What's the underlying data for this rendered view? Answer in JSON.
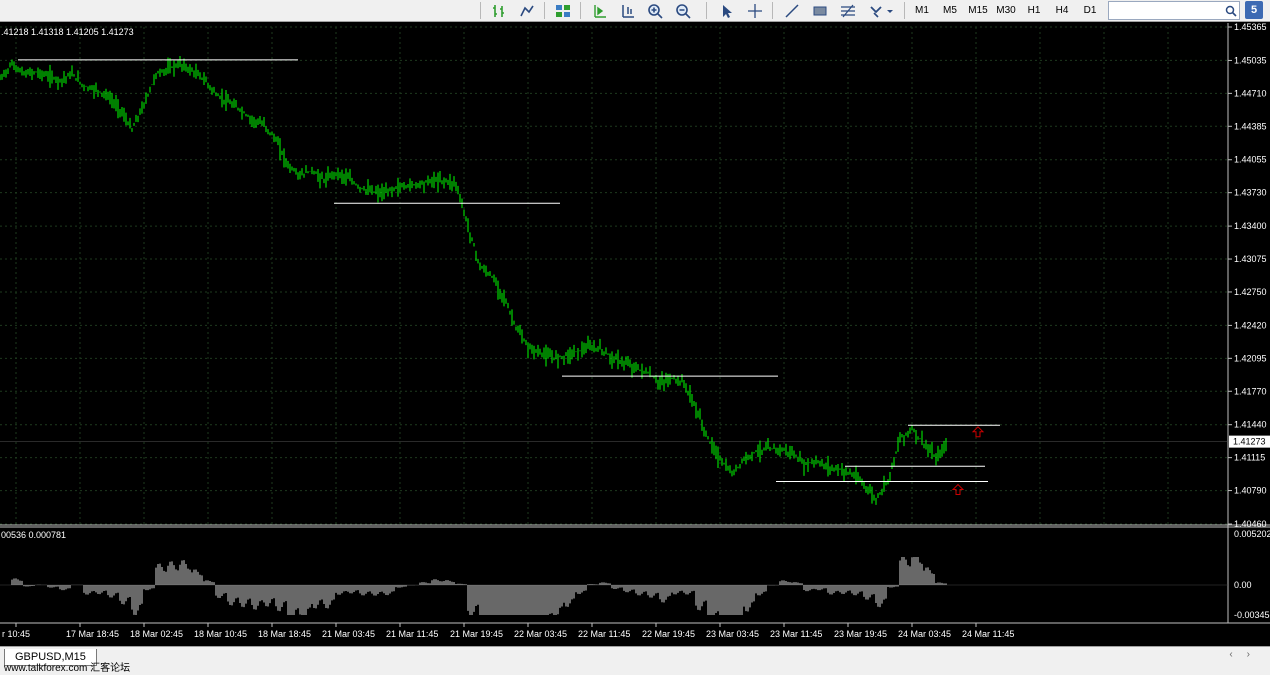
{
  "toolbar": {
    "timeframes": [
      "M1",
      "M5",
      "M15",
      "M30",
      "H1",
      "H4",
      "D1"
    ],
    "badge": "5"
  },
  "chart": {
    "ohlc_text": ".41218 1.41318 1.41205 1.41273",
    "current_price": "1.41273",
    "price_ticks": [
      "1.45365",
      "1.45035",
      "1.44710",
      "1.44385",
      "1.44055",
      "1.43730",
      "1.43400",
      "1.43075",
      "1.42750",
      "1.42420",
      "1.42095",
      "1.41770",
      "1.41440",
      "1.41115",
      "1.40790",
      "1.40460"
    ],
    "time_ticks": [
      "r 10:45",
      "17 Mar 18:45",
      "18 Mar 02:45",
      "18 Mar 10:45",
      "18 Mar 18:45",
      "21 Mar 03:45",
      "21 Mar 11:45",
      "21 Mar 19:45",
      "22 Mar 03:45",
      "22 Mar 11:45",
      "22 Mar 19:45",
      "23 Mar 03:45",
      "23 Mar 11:45",
      "23 Mar 19:45",
      "24 Mar 03:45",
      "24 Mar 11:45"
    ],
    "indicator_text": "00536 0.000781",
    "indicator_ticks": [
      "0.005202",
      "0.00",
      "-0.003458"
    ],
    "colors": {
      "bars": "#00ff00",
      "lines": "#ffffff",
      "arrows": "#cc0000",
      "grid": "#1e3a1e"
    }
  },
  "chart_data": {
    "type": "line",
    "title": "GBPUSD,M15",
    "ylim": [
      1.4046,
      1.45365
    ],
    "price_path": [
      [
        0,
        1.4485
      ],
      [
        2,
        1.45
      ],
      [
        4,
        1.449
      ],
      [
        6,
        1.4492
      ],
      [
        8,
        1.4488
      ],
      [
        10,
        1.4484
      ],
      [
        12,
        1.449
      ],
      [
        14,
        1.4478
      ],
      [
        16,
        1.4475
      ],
      [
        18,
        1.4468
      ],
      [
        20,
        1.4455
      ],
      [
        22,
        1.4435
      ],
      [
        24,
        1.446
      ],
      [
        26,
        1.449
      ],
      [
        28,
        1.4495
      ],
      [
        30,
        1.45
      ],
      [
        32,
        1.4493
      ],
      [
        34,
        1.4485
      ],
      [
        36,
        1.447
      ],
      [
        38,
        1.4462
      ],
      [
        40,
        1.4455
      ],
      [
        42,
        1.4445
      ],
      [
        44,
        1.444
      ],
      [
        46,
        1.4425
      ],
      [
        48,
        1.44
      ],
      [
        50,
        1.439
      ],
      [
        52,
        1.4395
      ],
      [
        54,
        1.4385
      ],
      [
        56,
        1.4393
      ],
      [
        58,
        1.4387
      ],
      [
        60,
        1.4378
      ],
      [
        62,
        1.4374
      ],
      [
        64,
        1.4372
      ],
      [
        66,
        1.4378
      ],
      [
        68,
        1.438
      ],
      [
        70,
        1.4382
      ],
      [
        72,
        1.4385
      ],
      [
        74,
        1.4385
      ],
      [
        76,
        1.4382
      ],
      [
        78,
        1.434
      ],
      [
        80,
        1.43
      ],
      [
        82,
        1.429
      ],
      [
        84,
        1.427
      ],
      [
        86,
        1.424
      ],
      [
        88,
        1.422
      ],
      [
        90,
        1.4215
      ],
      [
        92,
        1.421
      ],
      [
        94,
        1.4212
      ],
      [
        96,
        1.4216
      ],
      [
        98,
        1.422
      ],
      [
        100,
        1.4219
      ],
      [
        102,
        1.421
      ],
      [
        104,
        1.4205
      ],
      [
        106,
        1.42
      ],
      [
        108,
        1.4195
      ],
      [
        110,
        1.4185
      ],
      [
        112,
        1.419
      ],
      [
        114,
        1.4185
      ],
      [
        116,
        1.416
      ],
      [
        118,
        1.413
      ],
      [
        120,
        1.411
      ],
      [
        122,
        1.4095
      ],
      [
        124,
        1.411
      ],
      [
        126,
        1.4118
      ],
      [
        128,
        1.412
      ],
      [
        130,
        1.412
      ],
      [
        132,
        1.4116
      ],
      [
        134,
        1.4105
      ],
      [
        136,
        1.4108
      ],
      [
        138,
        1.4102
      ],
      [
        140,
        1.41
      ],
      [
        142,
        1.4095
      ],
      [
        144,
        1.4085
      ],
      [
        146,
        1.407
      ],
      [
        148,
        1.409
      ],
      [
        150,
        1.413
      ],
      [
        152,
        1.414
      ],
      [
        154,
        1.4125
      ],
      [
        156,
        1.411
      ],
      [
        158,
        1.4127
      ]
    ]
  },
  "tab": {
    "label": "GBPUSD,M15"
  },
  "watermark": "www.talkforex.com 汇客论坛"
}
